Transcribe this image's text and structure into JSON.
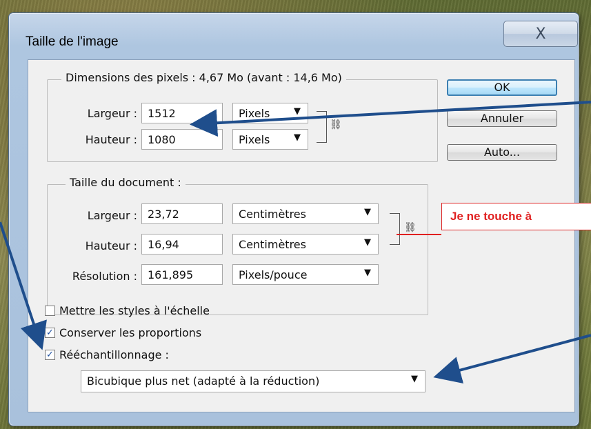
{
  "dialog": {
    "title": "Taille de l'image",
    "close_glyph": "X"
  },
  "pixel_group": {
    "legend": "Dimensions des pixels : 4,67 Mo (avant : 14,6 Mo)",
    "width_label": "Largeur :",
    "width_value": "1512",
    "width_unit": "Pixels",
    "height_label": "Hauteur :",
    "height_value": "1080",
    "height_unit": "Pixels"
  },
  "doc_group": {
    "legend": "Taille du document :",
    "width_label": "Largeur :",
    "width_value": "23,72",
    "width_unit": "Centimètres",
    "height_label": "Hauteur :",
    "height_value": "16,94",
    "height_unit": "Centimètres",
    "res_label": "Résolution :",
    "res_value": "161,895",
    "res_unit": "Pixels/pouce"
  },
  "buttons": {
    "ok": "OK",
    "cancel": "Annuler",
    "auto": "Auto..."
  },
  "options": {
    "scale_styles": {
      "label": "Mettre les styles à l'échelle",
      "checked": false
    },
    "constrain": {
      "label": "Conserver les proportions",
      "checked": true
    },
    "resample": {
      "label": "Rééchantillonnage :",
      "checked": true
    },
    "resample_method": "Bicubique plus net (adapté à la réduction)"
  },
  "annotation": {
    "callout_text": "Je ne touche à",
    "color": "#e02020",
    "arrow_color": "#1f4e8c"
  },
  "icons": {
    "dropdown": "▼",
    "check": "✓",
    "chain": "⛓"
  }
}
